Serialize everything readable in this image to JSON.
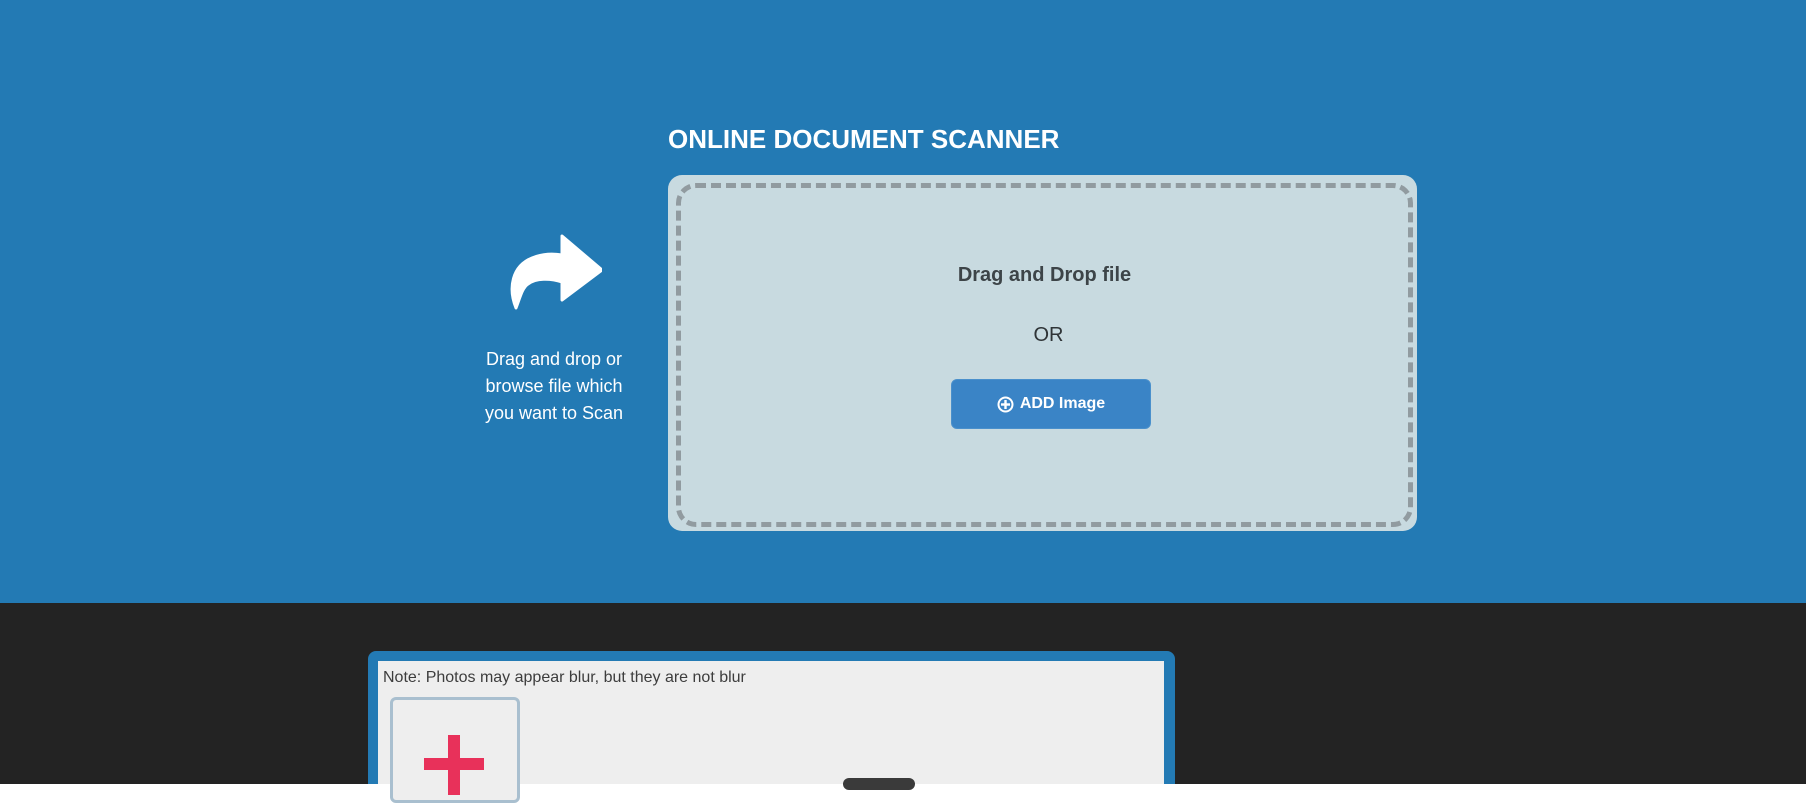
{
  "header": {
    "title": "ONLINE DOCUMENT SCANNER"
  },
  "hint": {
    "icon": "share-arrow-icon",
    "text": "Drag and drop or browse file which you want to Scan"
  },
  "dropzone": {
    "title": "Drag and Drop file",
    "or_text": "OR",
    "add_button_label": "ADD Image",
    "add_button_icon": "plus-circle-icon"
  },
  "preview": {
    "note": "Note: Photos may appear blur, but they are not blur",
    "add_tile_icon": "plus-icon"
  },
  "colors": {
    "hero_background": "#237ab4",
    "dropzone_background": "#c8dae0",
    "button_background": "#3a84c6",
    "dark_background": "#232323",
    "plus_accent": "#e8315a"
  }
}
